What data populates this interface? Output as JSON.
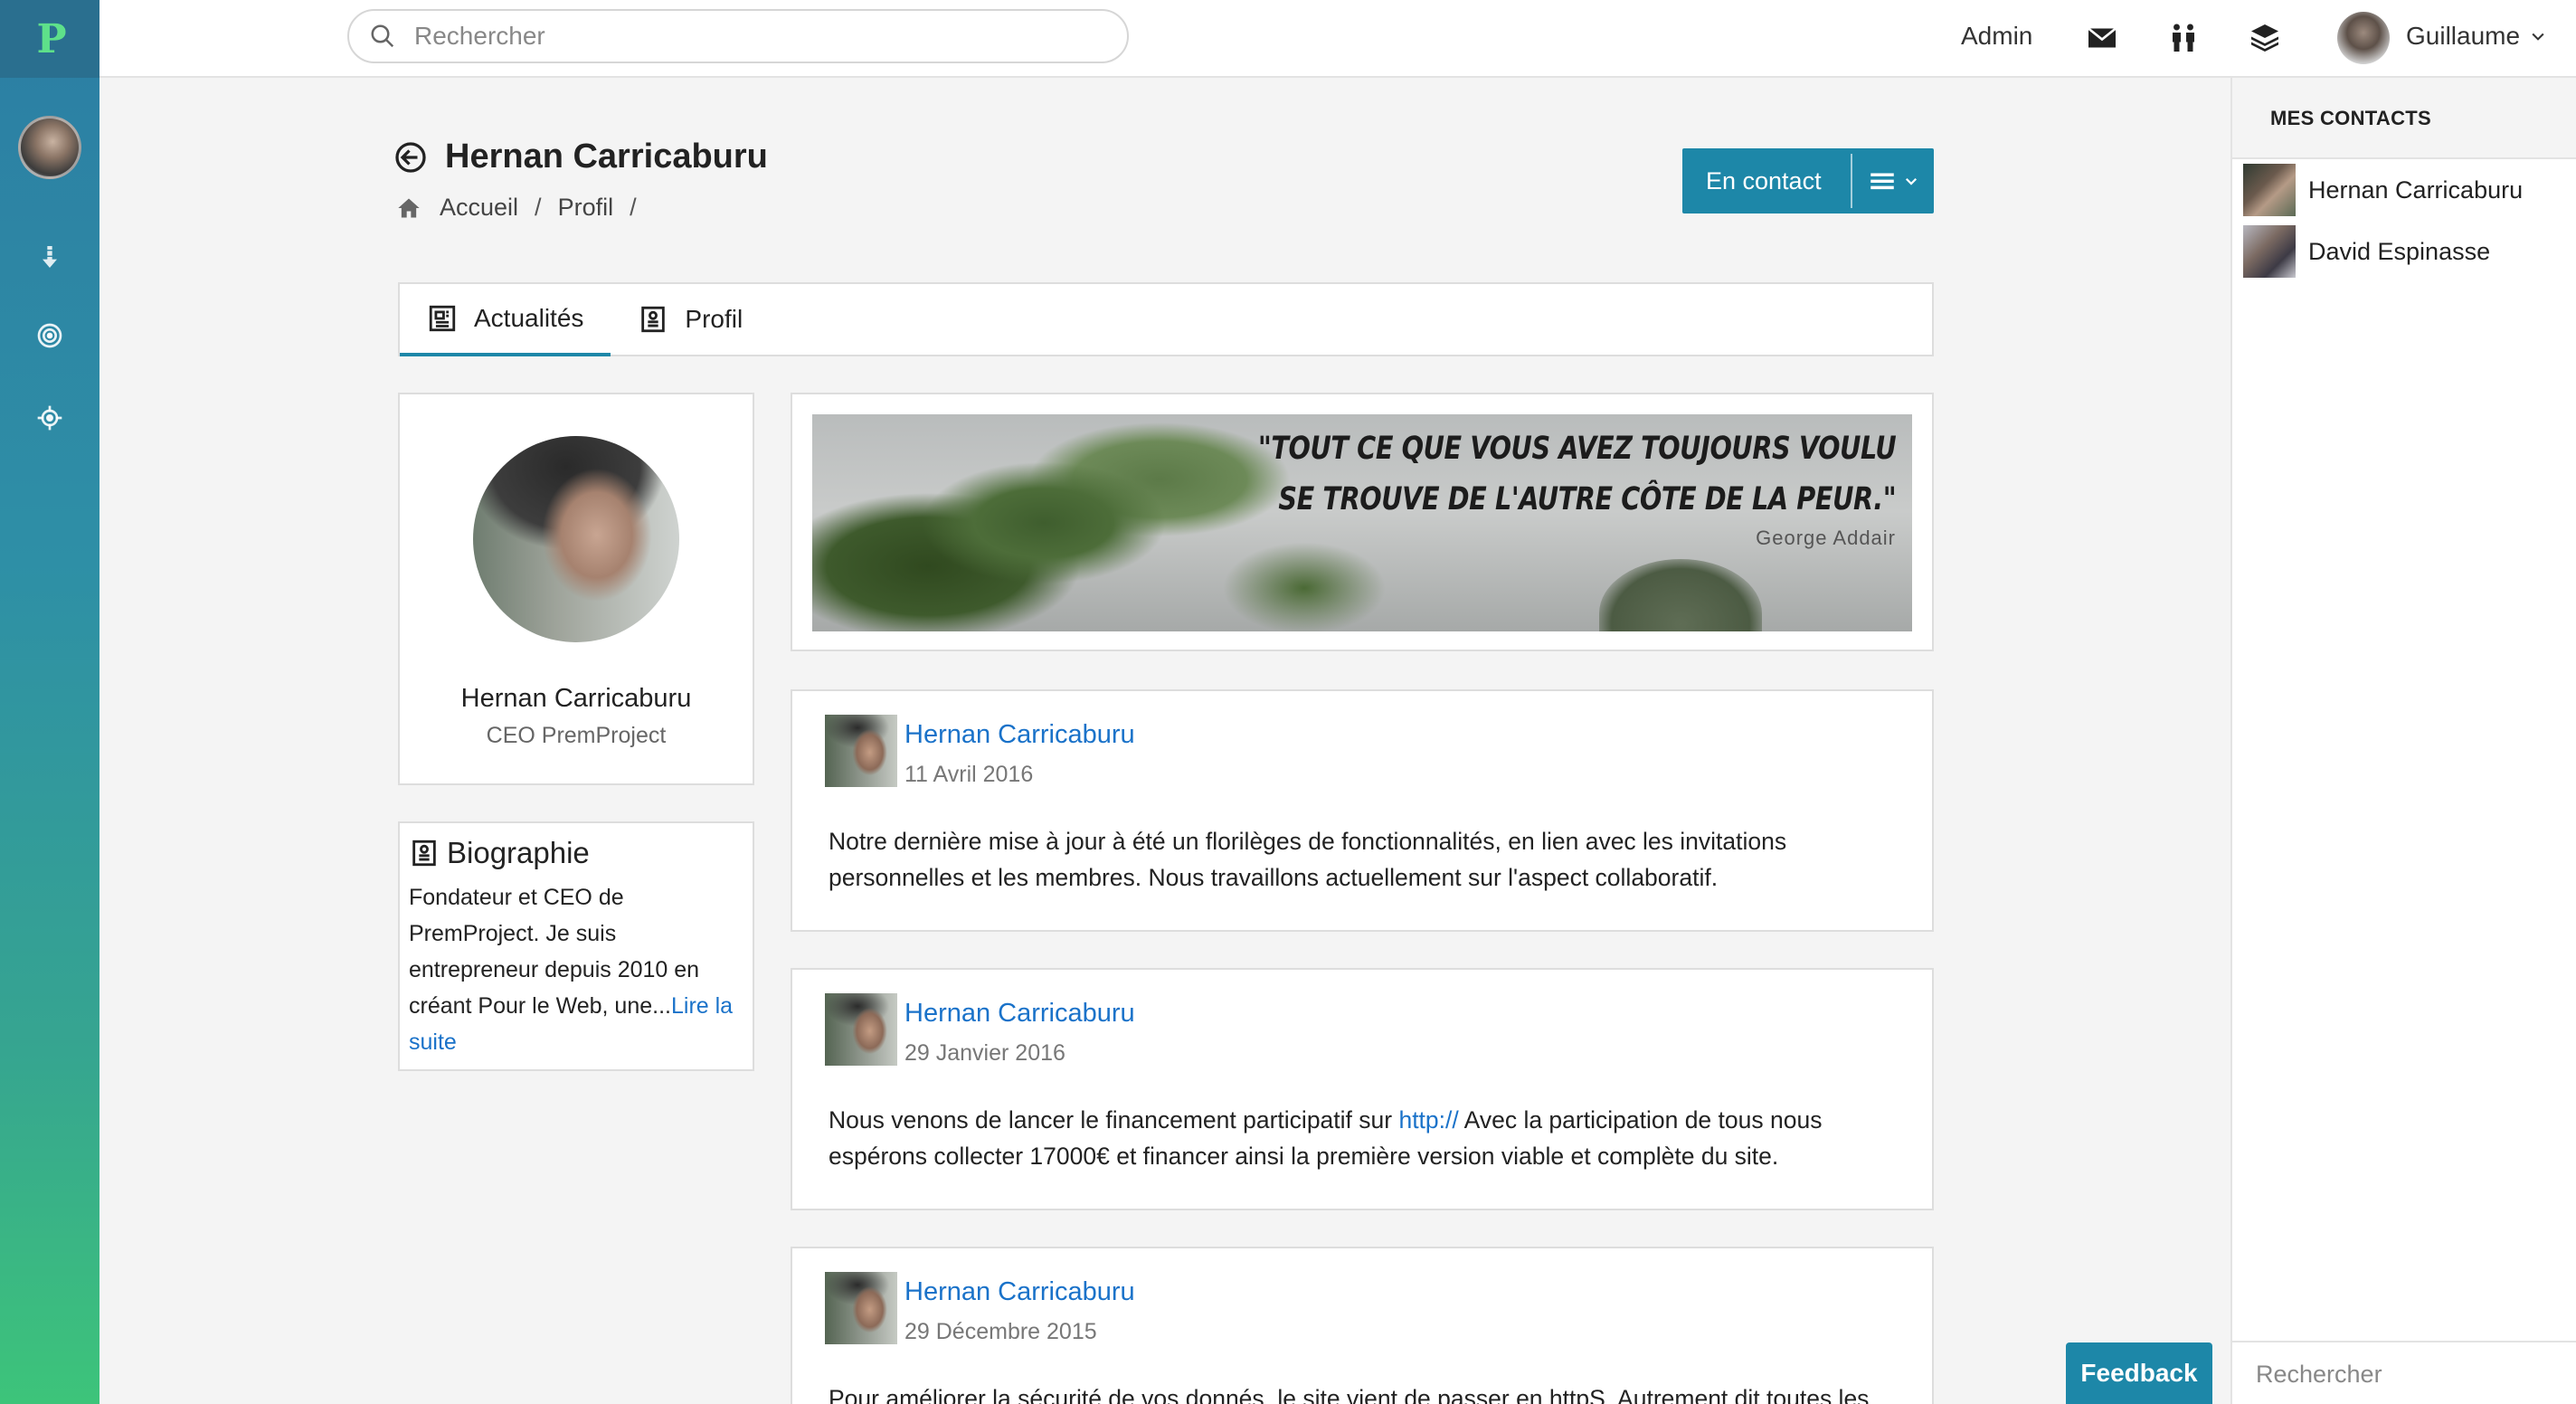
{
  "app": {
    "logo_text": "P"
  },
  "search": {
    "placeholder": "Rechercher"
  },
  "topbar": {
    "admin_label": "Admin",
    "user_name": "Guillaume",
    "icons": [
      "mail-icon",
      "people-icon",
      "layers-icon"
    ]
  },
  "sidebar": {
    "icons": [
      "download-icon",
      "target-icon",
      "crosshair-icon"
    ]
  },
  "page": {
    "title": "Hernan Carricaburu",
    "breadcrumb": [
      "Accueil",
      "Profil"
    ],
    "breadcrumb_sep": "/",
    "contact_button": "En contact"
  },
  "tabs": [
    {
      "label": "Actualités",
      "active": true
    },
    {
      "label": "Profil",
      "active": false
    }
  ],
  "profile": {
    "name": "Hernan Carricaburu",
    "role": "CEO PremProject"
  },
  "bio": {
    "title": "Biographie",
    "text": "Fondateur et CEO de PremProject. Je suis entrepreneur depuis 2010 en créant Pour le Web, une...",
    "read_more": "Lire la suite"
  },
  "banner": {
    "quote_line1": "\"TOUT CE QUE VOUS AVEZ TOUJOURS VOULU",
    "quote_line2": "SE TROUVE DE L'AUTRE CÔTE DE LA PEUR.\"",
    "author": "George Addair"
  },
  "posts": [
    {
      "author": "Hernan Carricaburu",
      "date": "11 Avril 2016",
      "body": "Notre dernière mise à jour à été un florilèges de fonctionnalités, en lien avec les invitations personnelles et les membres. Nous travaillons actuellement sur l'aspect collaboratif."
    },
    {
      "author": "Hernan Carricaburu",
      "date": "29 Janvier 2016",
      "body_before": "Nous venons de lancer le financement participatif sur ",
      "link": "http://",
      "body_after": " Avec la participation de tous nous espérons collecter 17000€ et financer ainsi la première version viable et complète du site."
    },
    {
      "author": "Hernan Carricaburu",
      "date": "29 Décembre 2015",
      "body": "Pour améliorer la sécurité de vos donnés, le site vient de passer en httpS. Autrement dit toutes les"
    }
  ],
  "contacts": {
    "title": "MES CONTACTS",
    "items": [
      {
        "name": "Hernan Carricaburu"
      },
      {
        "name": "David Espinasse"
      }
    ],
    "search_placeholder": "Rechercher"
  },
  "feedback": {
    "label": "Feedback"
  },
  "colors": {
    "accent": "#1d87a8",
    "link": "#1a72c9",
    "sidebar_top": "#2c7ea3",
    "sidebar_bottom": "#3dc47a"
  }
}
